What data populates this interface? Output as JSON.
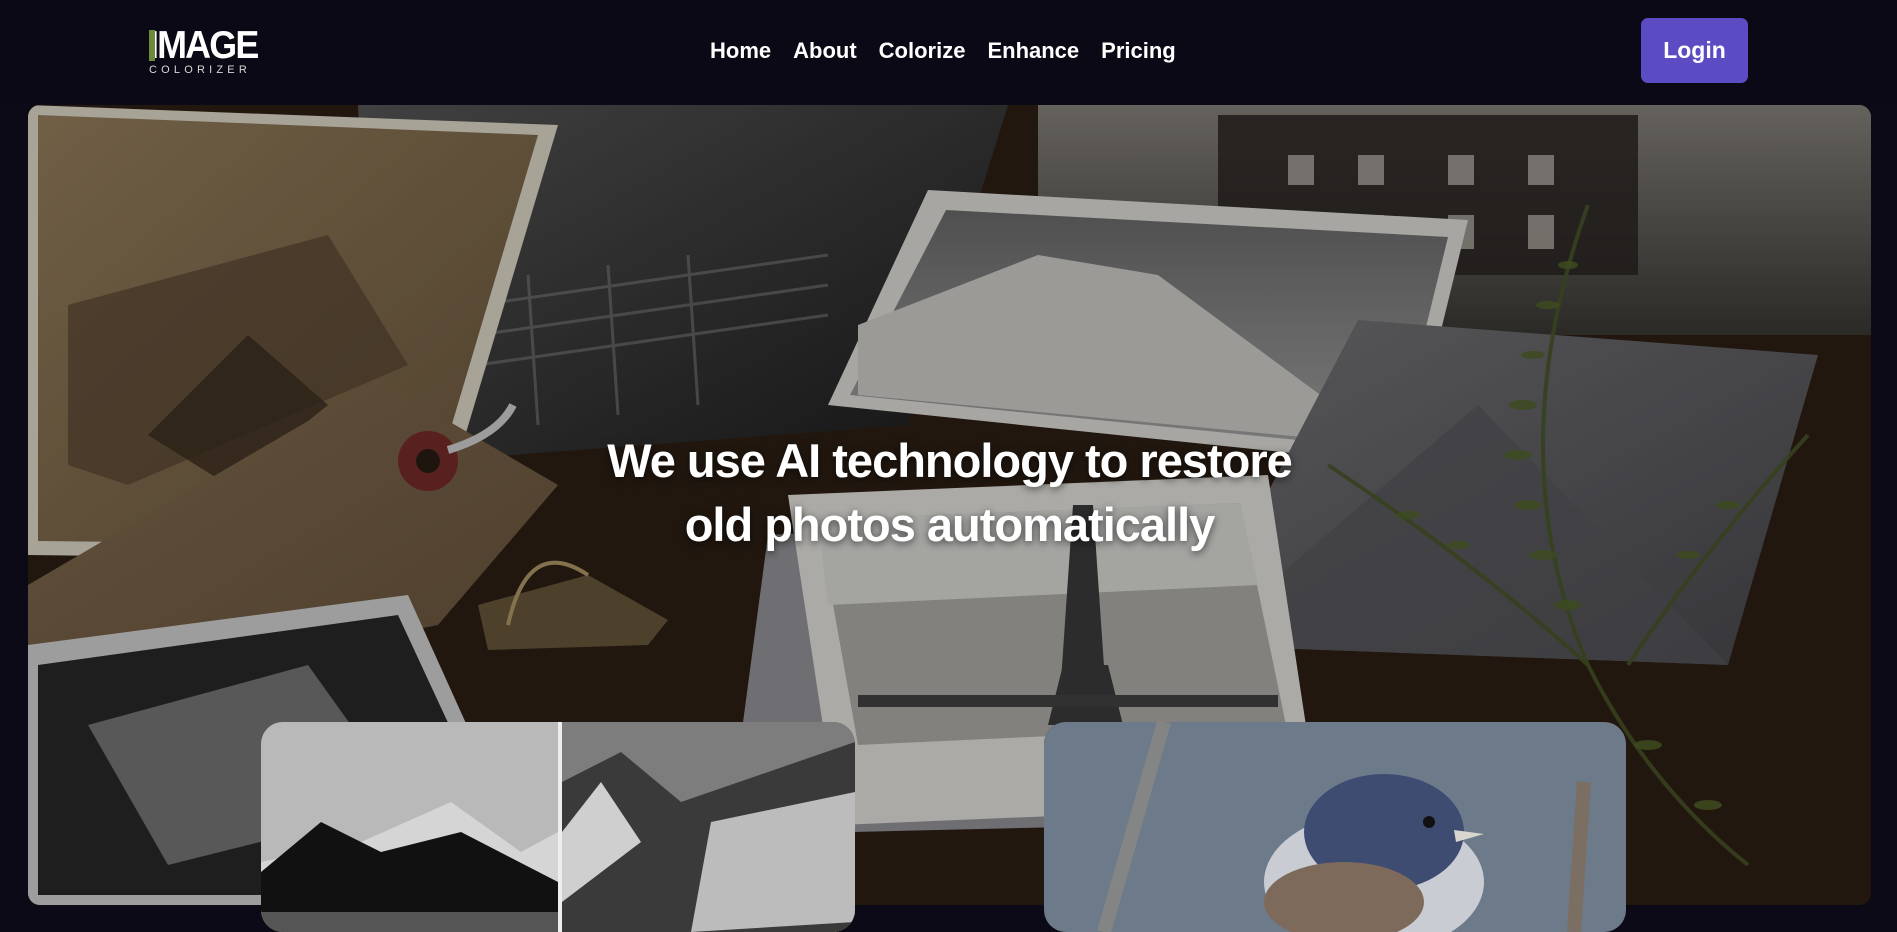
{
  "logo": {
    "main": "IMAGE",
    "sub": "COLORIZER"
  },
  "nav": {
    "items": [
      {
        "label": "Home"
      },
      {
        "label": "About"
      },
      {
        "label": "Colorize"
      },
      {
        "label": "Enhance"
      },
      {
        "label": "Pricing"
      }
    ],
    "login_label": "Login"
  },
  "hero": {
    "title_line1": "We use AI technology to restore",
    "title_line2": "old photos automatically"
  },
  "colors": {
    "background": "#0b0a16",
    "login_button": "#5b4cc4",
    "logo_accent": "#6d8a3a"
  }
}
